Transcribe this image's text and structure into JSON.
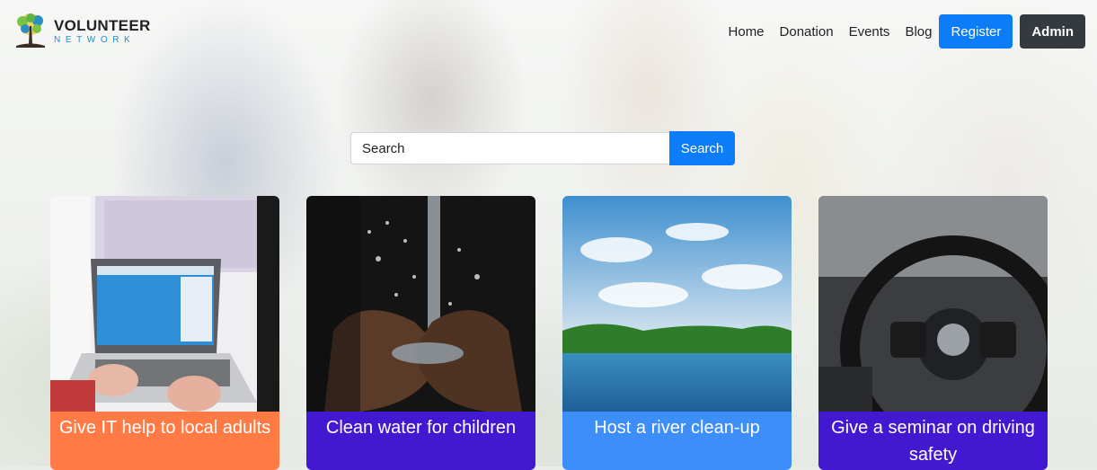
{
  "brand": {
    "name": "VOLUNTEER",
    "tagline": "NETWORK"
  },
  "nav": {
    "links": [
      "Home",
      "Donation",
      "Events",
      "Blog"
    ],
    "register_label": "Register",
    "admin_label": "Admin"
  },
  "search": {
    "placeholder": "Search",
    "button_label": "Search"
  },
  "cards": [
    {
      "title": "Give IT help to local adults",
      "color": "#ff7a45",
      "image": "laptop-typing"
    },
    {
      "title": "Clean water for children",
      "color": "#4318d1",
      "image": "water-hands"
    },
    {
      "title": "Host a river clean-up",
      "color": "#3d8ef8",
      "image": "river-sky"
    },
    {
      "title": "Give a seminar on driving safety",
      "color": "#4318d1",
      "image": "steering-wheel"
    }
  ]
}
